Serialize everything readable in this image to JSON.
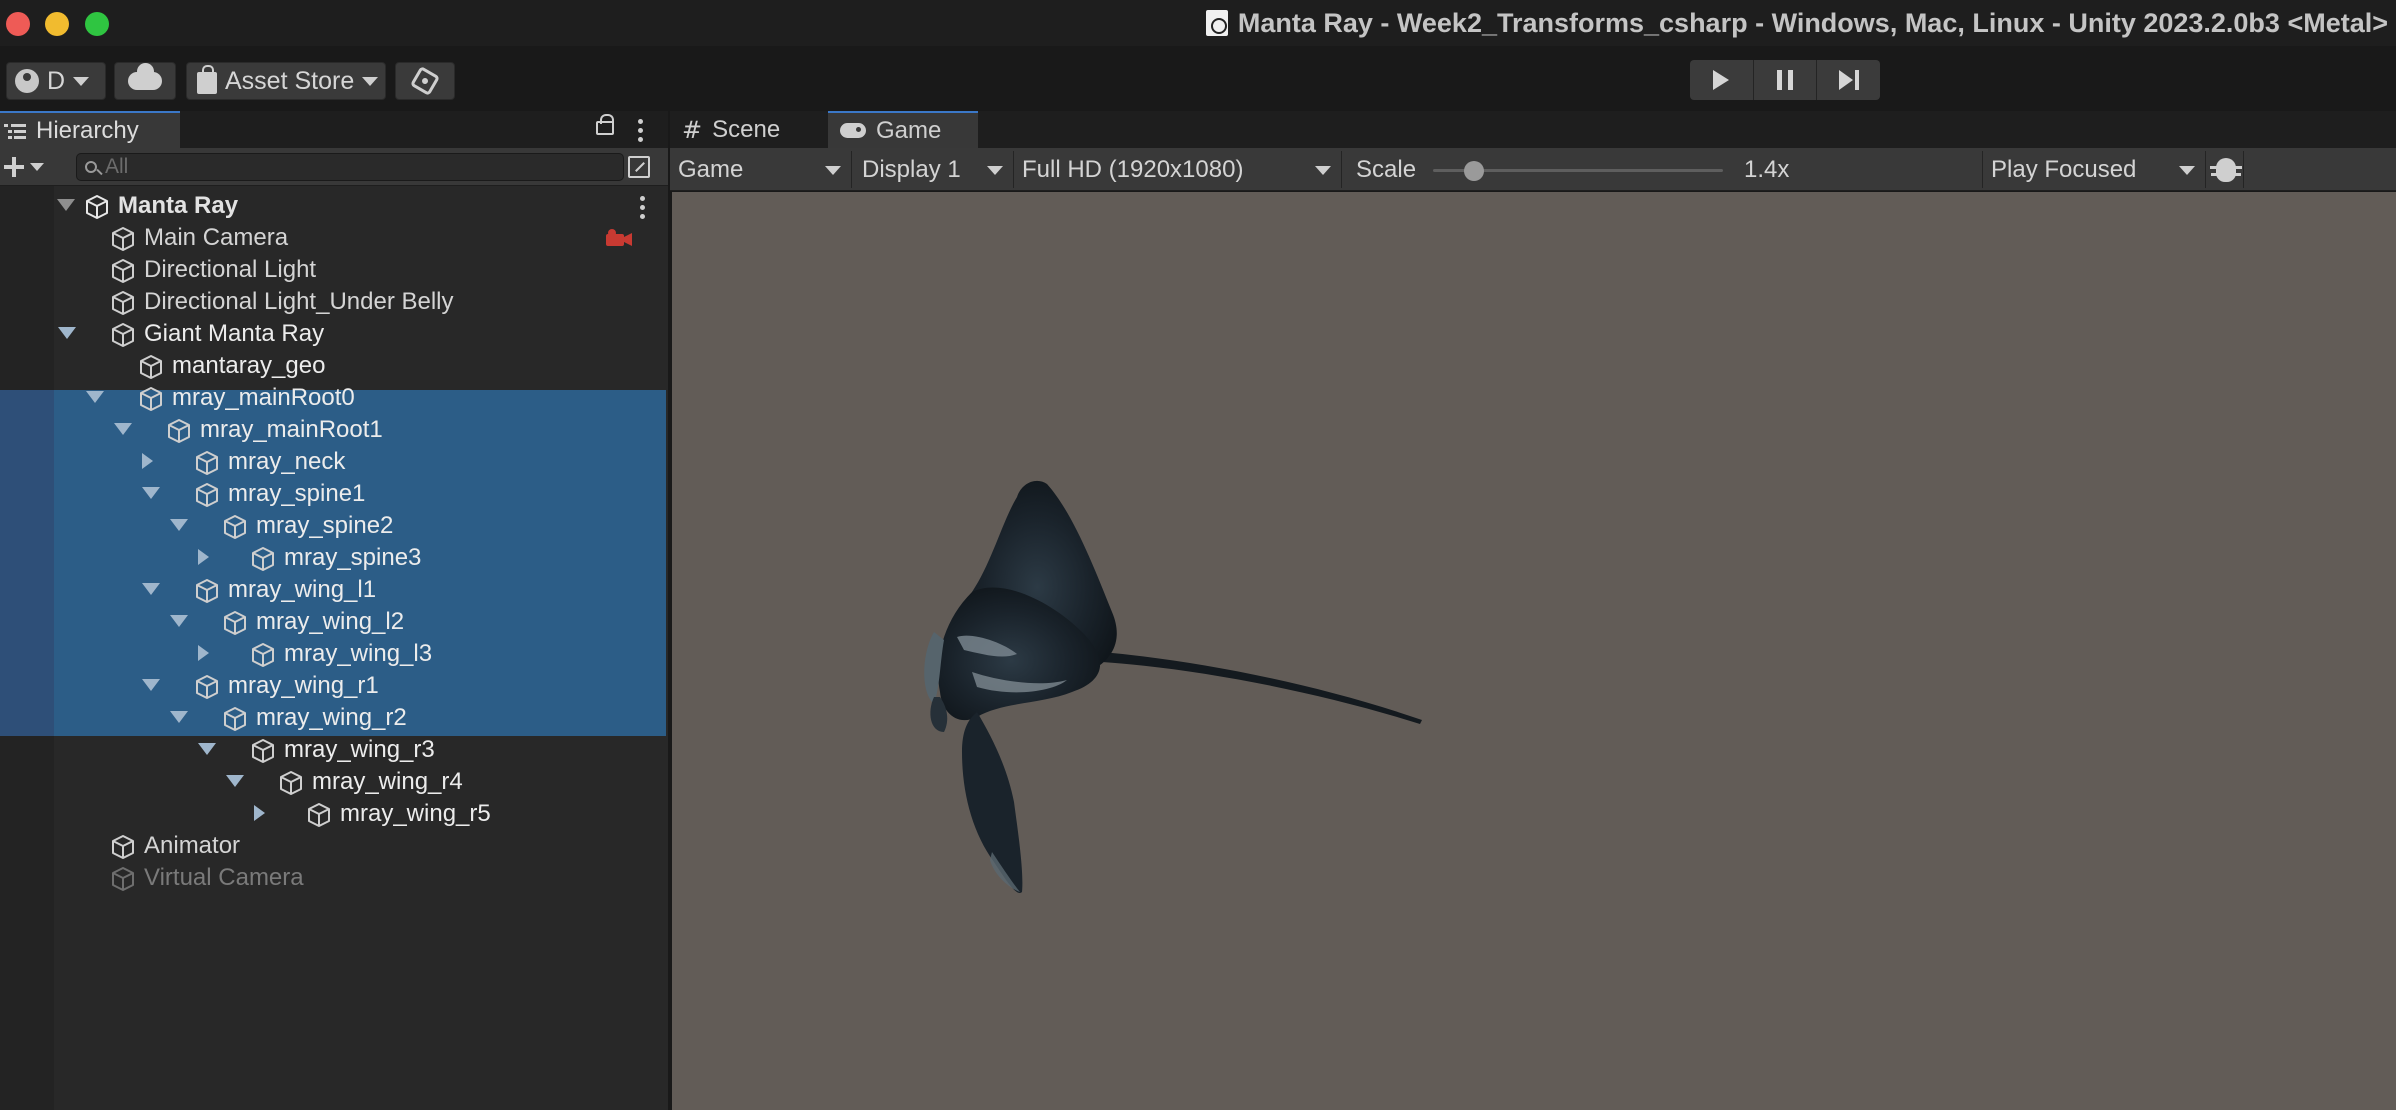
{
  "window": {
    "title": "Manta Ray - Week2_Transforms_csharp - Windows, Mac, Linux - Unity 2023.2.0b3 <Metal>"
  },
  "toolbar": {
    "account_label": "D",
    "asset_store_label": "Asset Store",
    "play_icon": "play-icon",
    "pause_icon": "pause-icon",
    "step_icon": "step-icon"
  },
  "hierarchy": {
    "tab_label": "Hierarchy",
    "search_placeholder": "All",
    "items": [
      {
        "label": "Manta Ray",
        "depth": 0,
        "expand": "down",
        "root": true
      },
      {
        "label": "Main Camera",
        "depth": 1
      },
      {
        "label": "Directional Light",
        "depth": 1
      },
      {
        "label": "Directional Light_Under Belly",
        "depth": 1
      },
      {
        "label": "Giant Manta Ray",
        "depth": 1,
        "expand": "down",
        "selected": true
      },
      {
        "label": "mantaray_geo",
        "depth": 2,
        "selected": true
      },
      {
        "label": "mray_mainRoot0",
        "depth": 2,
        "expand": "down",
        "selected": true
      },
      {
        "label": "mray_mainRoot1",
        "depth": 3,
        "expand": "down",
        "selected": true
      },
      {
        "label": "mray_neck",
        "depth": 4,
        "expand": "right",
        "selected": true
      },
      {
        "label": "mray_spine1",
        "depth": 4,
        "expand": "down",
        "selected": true
      },
      {
        "label": "mray_spine2",
        "depth": 5,
        "expand": "down",
        "selected": true
      },
      {
        "label": "mray_spine3",
        "depth": 6,
        "expand": "right",
        "selected": true
      },
      {
        "label": "mray_wing_l1",
        "depth": 4,
        "expand": "down",
        "selected": true
      },
      {
        "label": "mray_wing_l2",
        "depth": 5,
        "expand": "down",
        "selected": true
      },
      {
        "label": "mray_wing_l3",
        "depth": 6,
        "expand": "right",
        "selected": true
      },
      {
        "label": "mray_wing_r1",
        "depth": 4,
        "expand": "down",
        "selected": true
      },
      {
        "label": "mray_wing_r2",
        "depth": 5,
        "expand": "down",
        "selected": true
      },
      {
        "label": "mray_wing_r3",
        "depth": 6,
        "expand": "down",
        "selected": true
      },
      {
        "label": "mray_wing_r4",
        "depth": 7,
        "expand": "down",
        "selected": true
      },
      {
        "label": "mray_wing_r5",
        "depth": 8,
        "expand": "right",
        "selected": true
      },
      {
        "label": "Animator",
        "depth": 1
      },
      {
        "label": "Virtual Camera",
        "depth": 1,
        "disabled": true
      }
    ]
  },
  "game": {
    "tabs": [
      {
        "label": "Scene",
        "icon": "hash-icon"
      },
      {
        "label": "Game",
        "icon": "gamepad-icon",
        "active": true
      }
    ],
    "view_select": "Game",
    "display_select": "Display 1",
    "resolution_select": "Full HD (1920x1080)",
    "scale_label": "Scale",
    "scale_value": "1.4x",
    "scale_fraction": 0.14,
    "play_mode_select": "Play Focused",
    "viewport_bg": "#625c57"
  }
}
